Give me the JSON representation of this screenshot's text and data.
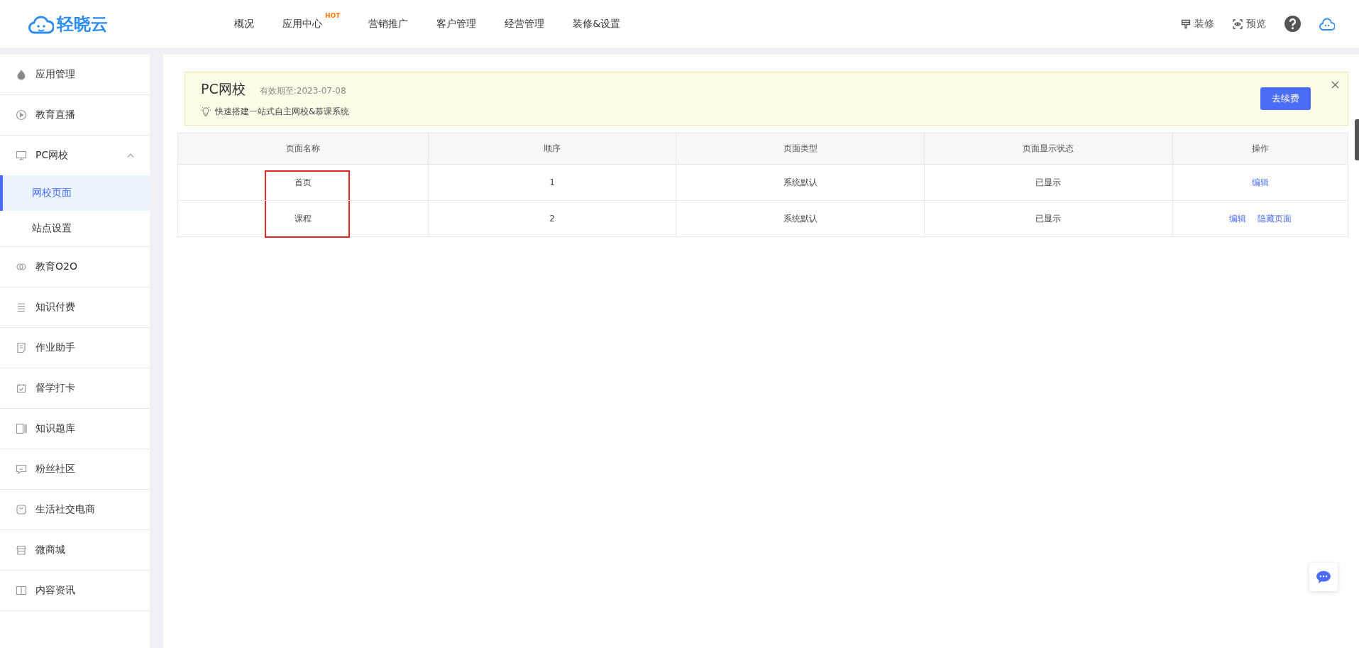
{
  "header": {
    "logo": "轻晓云",
    "nav": [
      {
        "label": "概况"
      },
      {
        "label": "应用中心",
        "badge": "HOT"
      },
      {
        "label": "营销推广"
      },
      {
        "label": "客户管理"
      },
      {
        "label": "经营管理"
      },
      {
        "label": "装修&设置"
      }
    ],
    "actions": [
      {
        "label": "装修",
        "kind": "decorate"
      },
      {
        "label": "预览",
        "kind": "preview"
      }
    ]
  },
  "sidebar": {
    "items": [
      {
        "label": "应用管理"
      },
      {
        "label": "教育直播"
      },
      {
        "label": "PC网校",
        "expanded": true,
        "children": [
          {
            "label": "网校页面",
            "selected": true
          },
          {
            "label": "站点设置",
            "selected": false
          }
        ]
      },
      {
        "label": "教育O2O"
      },
      {
        "label": "知识付费"
      },
      {
        "label": "作业助手"
      },
      {
        "label": "督学打卡"
      },
      {
        "label": "知识题库"
      },
      {
        "label": "粉丝社区"
      },
      {
        "label": "生活社交电商"
      },
      {
        "label": "微商城"
      },
      {
        "label": "内容资讯"
      }
    ]
  },
  "banner": {
    "title": "PC网校",
    "expiry": "有效期至:2023-07-08",
    "tip": "快速搭建一站式自主网校&慕课系统",
    "button": "去续费"
  },
  "table": {
    "columns": [
      "页面名称",
      "顺序",
      "页面类型",
      "页面显示状态",
      "操作"
    ],
    "rows": [
      {
        "name": "首页",
        "order": "1",
        "type": "系统默认",
        "status": "已显示",
        "actions": [
          "编辑"
        ],
        "highlighted": true
      },
      {
        "name": "课程",
        "order": "2",
        "type": "系统默认",
        "status": "已显示",
        "actions": [
          "编辑",
          "隐藏页面"
        ],
        "highlighted": true
      }
    ]
  }
}
